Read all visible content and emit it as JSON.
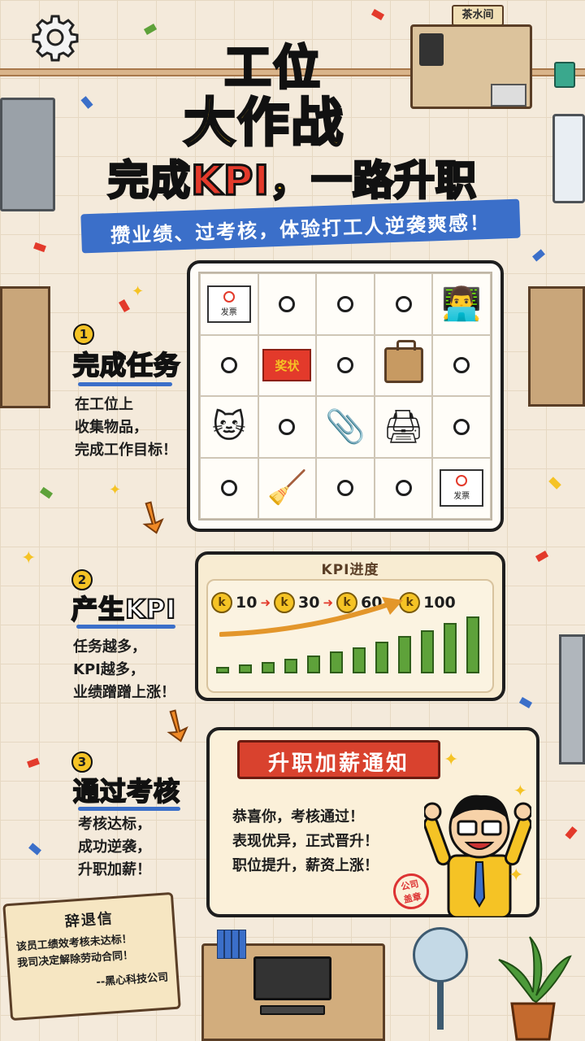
{
  "header": {
    "title_line1": "工位",
    "title_line2": "大作战",
    "subtitle_pre": "完成",
    "subtitle_kpi": "KPI",
    "subtitle_post": "，一路升职",
    "banner": "攒业绩、过考核，体验打工人逆袭爽感！"
  },
  "breakroom": {
    "sign": "茶水间"
  },
  "grid": {
    "rows": [
      [
        "receipt",
        "empty",
        "empty",
        "empty",
        "worker-at-computer"
      ],
      [
        "empty",
        "award",
        "empty",
        "briefcase",
        "empty"
      ],
      [
        "cat",
        "empty",
        "stapler",
        "printer",
        "empty"
      ],
      [
        "empty",
        "cleaner",
        "empty",
        "empty",
        "receipt"
      ]
    ],
    "award_label": "奖状",
    "receipt_label": "发票"
  },
  "steps": [
    {
      "number": "1",
      "title": "完成任务",
      "desc": [
        "在工位上",
        "收集物品，",
        "完成工作目标！"
      ]
    },
    {
      "number": "2",
      "title": "产生KPI",
      "desc": [
        "任务越多，",
        "KPI越多，",
        "业绩蹭蹭上涨！"
      ]
    },
    {
      "number": "3",
      "title": "通过考核",
      "desc": [
        "考核达标，",
        "成功逆袭，",
        "升职加薪！"
      ]
    }
  ],
  "kpi": {
    "title": "KPI进度",
    "coin_letter": "k",
    "milestones": [
      "10",
      "30",
      "60",
      "100"
    ],
    "bar_levels": [
      0.12,
      0.16,
      0.2,
      0.26,
      0.32,
      0.38,
      0.46,
      0.55,
      0.65,
      0.76,
      0.88,
      1.0
    ]
  },
  "promotion": {
    "title": "升职加薪通知",
    "lines": [
      "恭喜你，考核通过！",
      "表现优异，正式晋升！",
      "职位提升，薪资上涨！"
    ],
    "stamp": [
      "公司",
      "盖章"
    ]
  },
  "resignation": {
    "title": "辞退信",
    "lines": [
      "该员工绩效考核未达标！",
      "我司决定解除劳动合同！"
    ],
    "signature": "--黑心科技公司"
  },
  "colors": {
    "accent_blue": "#3b6fc9",
    "accent_red": "#e33a2b",
    "accent_yellow": "#f5c325",
    "bar_green": "#5ea23a"
  }
}
